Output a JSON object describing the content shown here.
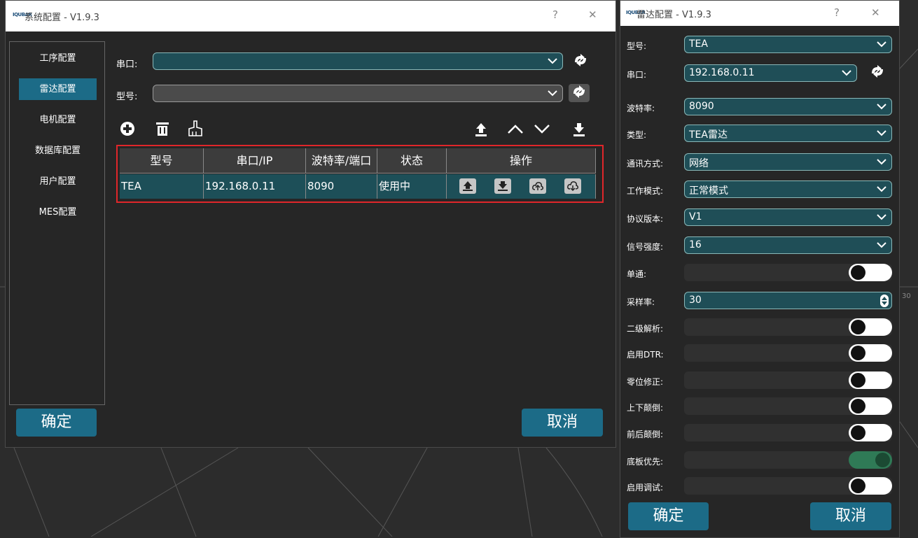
{
  "sys_window": {
    "title": "系统配置 - V1.9.3",
    "help": "?",
    "close": "✕",
    "logo": "IQUBAR",
    "sidebar": [
      {
        "label": "工序配置",
        "active": false
      },
      {
        "label": "雷达配置",
        "active": true
      },
      {
        "label": "电机配置",
        "active": false
      },
      {
        "label": "数据库配置",
        "active": false
      },
      {
        "label": "用户配置",
        "active": false
      },
      {
        "label": "MES配置",
        "active": false
      }
    ],
    "port_label": "串口:",
    "port_value": "",
    "model_label": "型号:",
    "model_value": "",
    "table": {
      "headers": [
        "型号",
        "串口/IP",
        "波特率/端口",
        "状态",
        "操作"
      ],
      "rows": [
        {
          "model": "TEA",
          "port": "192.168.0.11",
          "baud": "8090",
          "status": "使用中"
        }
      ]
    },
    "ok": "确定",
    "cancel": "取消"
  },
  "radar_window": {
    "title": "雷达配置 - V1.9.3",
    "help": "?",
    "close": "✕",
    "logo": "IQUBAR",
    "fields": [
      {
        "label": "型号:",
        "type": "combo",
        "value": "TEA"
      },
      {
        "label": "串口:",
        "type": "combo-refresh",
        "value": "192.168.0.11"
      },
      {
        "label": "波特率:",
        "type": "combo",
        "value": "8090"
      },
      {
        "label": "类型:",
        "type": "combo",
        "value": "TEA雷达"
      },
      {
        "label": "通讯方式:",
        "type": "combo",
        "value": "网络"
      },
      {
        "label": "工作模式:",
        "type": "combo",
        "value": "正常模式"
      },
      {
        "label": "协议版本:",
        "type": "combo",
        "value": "V1"
      },
      {
        "label": "信号强度:",
        "type": "combo",
        "value": "16"
      },
      {
        "label": "单通:",
        "type": "toggle",
        "value": false
      },
      {
        "label": "采样率:",
        "type": "spin",
        "value": "30"
      },
      {
        "label": "二级解析:",
        "type": "toggle",
        "value": false
      },
      {
        "label": "启用DTR:",
        "type": "toggle",
        "value": false
      },
      {
        "label": "零位修正:",
        "type": "toggle",
        "value": false
      },
      {
        "label": "上下颠倒:",
        "type": "toggle",
        "value": false
      },
      {
        "label": "前后颠倒:",
        "type": "toggle",
        "value": false
      },
      {
        "label": "底板优先:",
        "type": "toggle",
        "value": true
      },
      {
        "label": "启用调试:",
        "type": "toggle",
        "value": false
      }
    ],
    "ok": "确定",
    "cancel": "取消"
  },
  "background_label": "30",
  "colors": {
    "accent": "#1c6b87",
    "selected_row": "#1d4f58",
    "highlight_border": "#e0262a",
    "toggle_on": "#2f7a56"
  }
}
